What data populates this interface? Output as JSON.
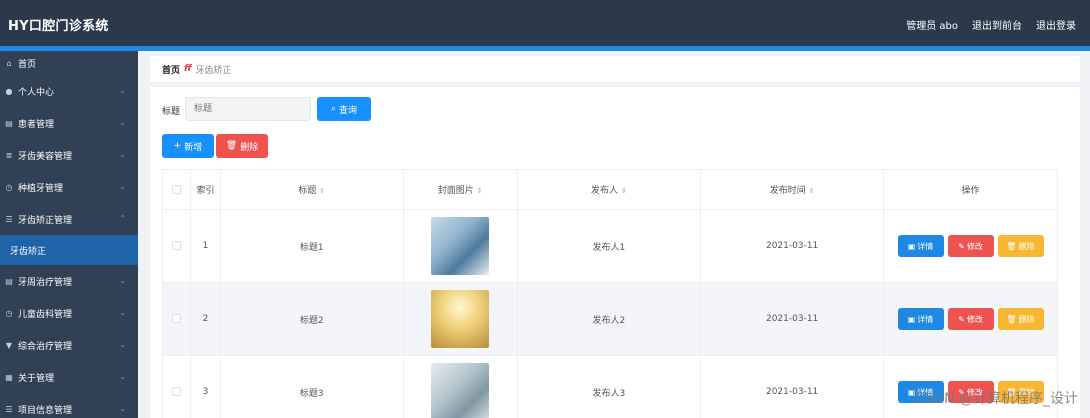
{
  "app": {
    "title": "HY口腔门诊系统"
  },
  "topbar": {
    "admin": "管理员 abo",
    "to_front": "退出到前台",
    "logout": "退出登录"
  },
  "sidebar": {
    "items": [
      {
        "label": "首页",
        "icon": "home-icon"
      },
      {
        "label": "个人中心",
        "icon": "user-icon"
      },
      {
        "label": "患者管理",
        "icon": "document-icon"
      },
      {
        "label": "牙齿美容管理",
        "icon": "layers-icon"
      },
      {
        "label": "种植牙管理",
        "icon": "clock-icon"
      },
      {
        "label": "牙齿矫正管理",
        "icon": "list-icon",
        "expanded": true
      },
      {
        "label": "牙齿矫正",
        "active": true
      },
      {
        "label": "牙周治疗管理",
        "icon": "document-icon"
      },
      {
        "label": "儿童齿科管理",
        "icon": "clock-icon"
      },
      {
        "label": "综合治疗管理",
        "icon": "filter-icon"
      },
      {
        "label": "关于管理",
        "icon": "grid-icon"
      },
      {
        "label": "项目信息管理",
        "icon": "list-icon"
      }
    ]
  },
  "breadcrumb": {
    "home": "首页",
    "separator": "ff",
    "current": "牙齿矫正"
  },
  "search": {
    "label": "标题",
    "placeholder": "标题",
    "button": "查询"
  },
  "actions": {
    "add": "新增",
    "delete": "删除"
  },
  "table": {
    "headers": {
      "index": "索引",
      "title": "标题",
      "cover": "封面图片",
      "publisher": "发布人",
      "time": "发布时间",
      "ops": "操作"
    },
    "rows": [
      {
        "index": "1",
        "title": "标题1",
        "publisher": "发布人1",
        "time": "2021-03-11"
      },
      {
        "index": "2",
        "title": "标题2",
        "publisher": "发布人2",
        "time": "2021-03-11"
      },
      {
        "index": "3",
        "title": "标题3",
        "publisher": "发布人3",
        "time": "2021-03-11"
      }
    ],
    "row_buttons": {
      "detail": "详情",
      "edit": "修改",
      "remove": "删除"
    }
  },
  "watermark": "CSDN @计算机程序_设计",
  "colors": {
    "topbar": "#2b3a4a",
    "sidebar": "#304156",
    "accent": "#1e88e5",
    "active": "#1f63a8",
    "primary": "#1890ff",
    "danger": "#ef5350",
    "warning": "#f7b733"
  }
}
